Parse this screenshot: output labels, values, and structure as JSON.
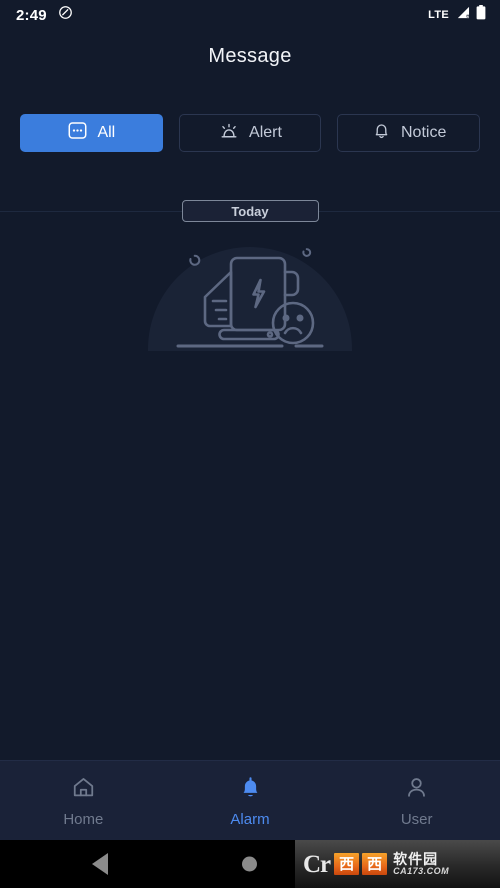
{
  "theme": {
    "background": "#121a2b",
    "accent": "#3b7ddd",
    "nav_background": "#1a2238",
    "muted_text": "#707a8e",
    "border": "#2b3650"
  },
  "status_bar": {
    "time": "2:49",
    "dnd_icon": "do-not-disturb-icon",
    "network_label": "LTE",
    "signal_icon": "signal-bars-icon",
    "battery_icon": "battery-full-icon"
  },
  "header": {
    "title": "Message"
  },
  "filter_tabs": [
    {
      "id": "all",
      "label": "All",
      "icon": "message-dots-icon",
      "active": true
    },
    {
      "id": "alert",
      "label": "Alert",
      "icon": "siren-icon",
      "active": false
    },
    {
      "id": "notice",
      "label": "Notice",
      "icon": "bell-icon",
      "active": false
    }
  ],
  "date_divider": {
    "label": "Today"
  },
  "empty_state": {
    "illustration": "no-data-power-bank-sad-face-illustration",
    "message": ""
  },
  "bottom_nav": [
    {
      "id": "home",
      "label": "Home",
      "icon": "home-icon",
      "active": false
    },
    {
      "id": "alarm",
      "label": "Alarm",
      "icon": "bell-filled-icon",
      "active": true
    },
    {
      "id": "user",
      "label": "User",
      "icon": "person-icon",
      "active": false
    }
  ],
  "system_nav": {
    "back_icon": "back-triangle-icon",
    "home_icon": "home-circle-icon"
  },
  "watermark": {
    "logo": "Cr",
    "box1": "西",
    "box2": "西",
    "name": "软件园",
    "url": "CA173.COM"
  }
}
